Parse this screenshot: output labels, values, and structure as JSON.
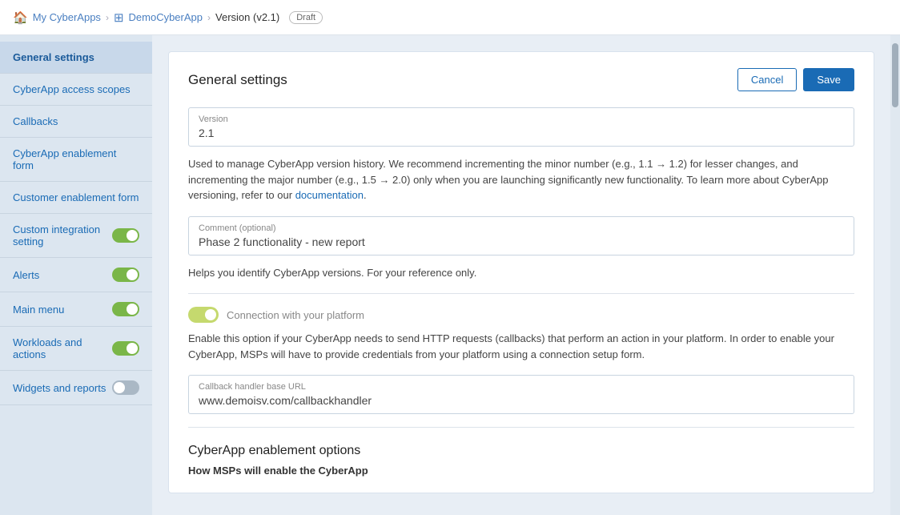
{
  "breadcrumb": {
    "home_icon": "🏠",
    "home_label": "My CyberApps",
    "sep1": "›",
    "app_icon": "⊞",
    "app_label": "DemoCyberApp",
    "sep2": "›",
    "version_label": "Version (v2.1)",
    "draft_badge": "Draft"
  },
  "sidebar": {
    "items": [
      {
        "id": "general-settings",
        "label": "General settings",
        "active": true,
        "has_toggle": false
      },
      {
        "id": "cyberapp-access-scopes",
        "label": "CyberApp access scopes",
        "active": false,
        "has_toggle": false
      },
      {
        "id": "callbacks",
        "label": "Callbacks",
        "active": false,
        "has_toggle": false
      },
      {
        "id": "cyberapp-enablement-form",
        "label": "CyberApp enablement form",
        "active": false,
        "has_toggle": false
      },
      {
        "id": "customer-enablement-form",
        "label": "Customer enablement form",
        "active": false,
        "has_toggle": false
      },
      {
        "id": "custom-integration-setting",
        "label": "Custom integration setting",
        "active": false,
        "has_toggle": true,
        "toggle_on": true
      },
      {
        "id": "alerts",
        "label": "Alerts",
        "active": false,
        "has_toggle": true,
        "toggle_on": true
      },
      {
        "id": "main-menu",
        "label": "Main menu",
        "active": false,
        "has_toggle": true,
        "toggle_on": true
      },
      {
        "id": "workloads-and-actions",
        "label": "Workloads and actions",
        "active": false,
        "has_toggle": true,
        "toggle_on": true
      },
      {
        "id": "widgets-and-reports",
        "label": "Widgets and reports",
        "active": false,
        "has_toggle": true,
        "toggle_on": false
      }
    ]
  },
  "card": {
    "title": "General settings",
    "cancel_label": "Cancel",
    "save_label": "Save",
    "version_field_label": "Version",
    "version_value": "2.1",
    "info_text_part1": "Used to manage CyberApp version history. We recommend incrementing the minor number (e.g., 1.1 → 1.2) for lesser changes, and incrementing the major number (e.g., 1.5 → 2.0) only when you are launching significantly new functionality. To learn more about CyberApp versioning, refer to our ",
    "info_link_label": "documentation",
    "info_text_part2": ".",
    "comment_field_label": "Comment (optional)",
    "comment_value": "Phase 2 functionality - new report",
    "comment_help_text": "Helps you identify CyberApp versions. For your reference only.",
    "connection_label": "Connection with your platform",
    "connection_toggle_on": true,
    "connection_info": "Enable this option if your CyberApp needs to send HTTP requests (callbacks) that perform an action in your platform. In order to enable your CyberApp, MSPs will have to provide credentials from your platform using a connection setup form.",
    "callback_url_label": "Callback handler base URL",
    "callback_url_value": "www.demoisv.com/callbackhandler",
    "cyberapp_enablement_title": "CyberApp enablement options",
    "how_msps_label": "How MSPs will enable the CyberApp"
  }
}
